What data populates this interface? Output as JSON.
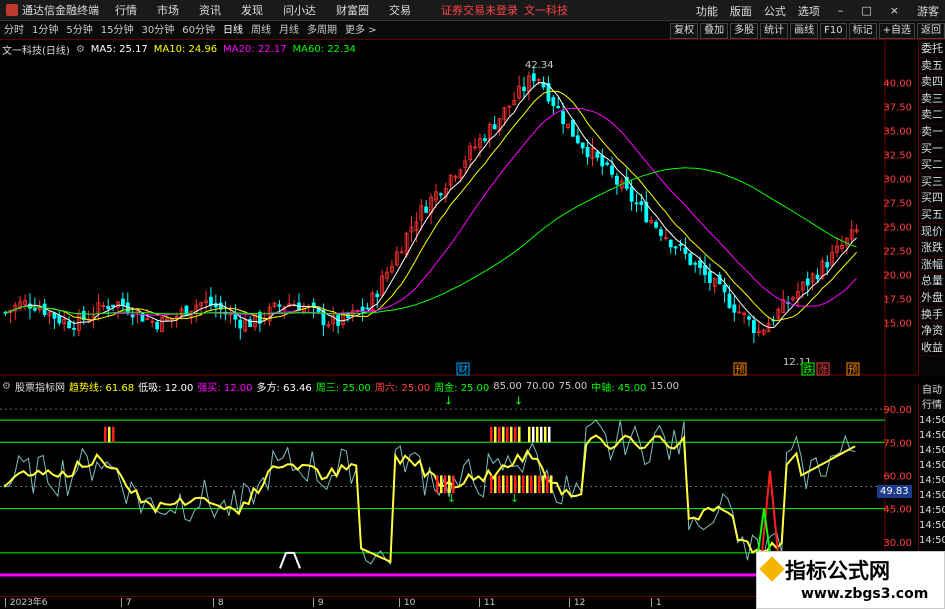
{
  "window": {
    "app_title": "通达信金融终端",
    "menu": [
      "行情",
      "市场",
      "资讯",
      "发现",
      "问小达",
      "财富圈",
      "交易"
    ],
    "notice": "证券交易未登录",
    "stock_name_top": "文一科技",
    "right_menu": [
      "功能",
      "版面",
      "公式",
      "选项"
    ],
    "guest_label": "游客"
  },
  "tabs": [
    "分时",
    "1分钟",
    "5分钟",
    "15分钟",
    "30分钟",
    "60分钟",
    "日线",
    "周线",
    "月线",
    "多周期",
    "更多 >"
  ],
  "active_tab": "日线",
  "right_tools": [
    "复权",
    "叠加",
    "多股",
    "统计",
    "画线",
    "F10",
    "标记",
    "+自选",
    "返回"
  ],
  "price_panel": {
    "title": "文一科技(日线)",
    "ma5": "MA5: 25.17",
    "ma10": "MA10: 24.96",
    "ma20": "MA20: 22.17",
    "ma60": "MA60: 22.34",
    "high_label": "42.34",
    "low_label": "12.11",
    "axis_labels": [
      "40.00",
      "37.50",
      "35.00",
      "32.50",
      "30.00",
      "27.50",
      "25.00",
      "22.50",
      "20.00",
      "17.50",
      "15.00"
    ],
    "markers": [
      "财",
      "预",
      "跌",
      "涨",
      "预"
    ]
  },
  "side_panel": [
    "委托",
    "卖五",
    "卖四",
    "卖三",
    "卖二",
    "卖一",
    "买一",
    "买二",
    "买三",
    "买四",
    "买五",
    "现价",
    "涨跌",
    "涨幅",
    "总量",
    "外盘",
    "换手",
    "净资",
    "收益"
  ],
  "side_panel2": [
    "自动",
    "行情",
    "14:50",
    "14:50",
    "14:50",
    "14:50",
    "14:50",
    "14:50",
    "14:50",
    "14:50",
    "14:50",
    "14:50",
    "14:50"
  ],
  "indicator_panel": {
    "name": "股票指标网",
    "trend": "趋势线: 61.68",
    "low": "低吸: 12.00",
    "strong_buy": "强买: 12.00",
    "bull": "多方: 63.46",
    "l1": "周三: 25.00",
    "l2": "周六: 25.00",
    "l3": "周金: 25.00",
    "l4": "85.00",
    "l5": "70.00",
    "l6": "75.00",
    "mid_axis": "中轴: 45.00",
    "l7": "15.00",
    "axis_labels": [
      "90.00",
      "75.00",
      "60.00",
      "45.00",
      "30.00"
    ],
    "current_value": "49.83"
  },
  "dates": [
    "2023年6",
    "7",
    "8",
    "9",
    "10",
    "11",
    "12",
    "1"
  ],
  "watermark": {
    "title": "指标公式网",
    "url": "www.zbgs3.com"
  },
  "colors": {
    "up": "#ff3030",
    "down": "#00ffff",
    "ma5": "#ffffff",
    "ma10": "#ffff00",
    "ma20": "#ff00ff",
    "ma60": "#00ff00"
  }
}
